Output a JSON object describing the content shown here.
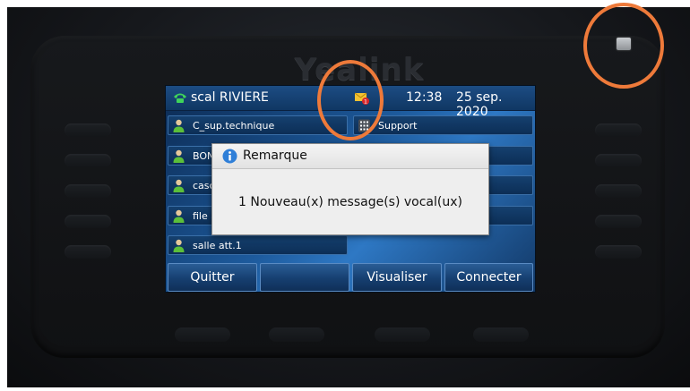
{
  "status_bar": {
    "line_name": "scal RIVIERE",
    "time": "12:38",
    "date": "25 sep. 2020",
    "voicemail_count": "1"
  },
  "brand": "Yealink",
  "dss_keys": [
    {
      "label": "C_sup.technique",
      "icon": "user-icon"
    },
    {
      "label": "Support",
      "icon": "dialpad-icon"
    },
    {
      "label": "BON",
      "icon": "user-icon"
    },
    {
      "label": "casc",
      "icon": "user-icon"
    },
    {
      "label": "file a",
      "icon": "user-icon"
    },
    {
      "label": "salle att.1",
      "icon": "user-icon"
    }
  ],
  "dialog": {
    "title": "Remarque",
    "message": "1 Nouveau(x) message(s) vocal(ux)"
  },
  "softkeys": [
    "Quitter",
    "",
    "Visualiser",
    "Connecter"
  ],
  "colors": {
    "highlight": "#ee7a3a",
    "screen_accent": "#1d5a9c"
  }
}
